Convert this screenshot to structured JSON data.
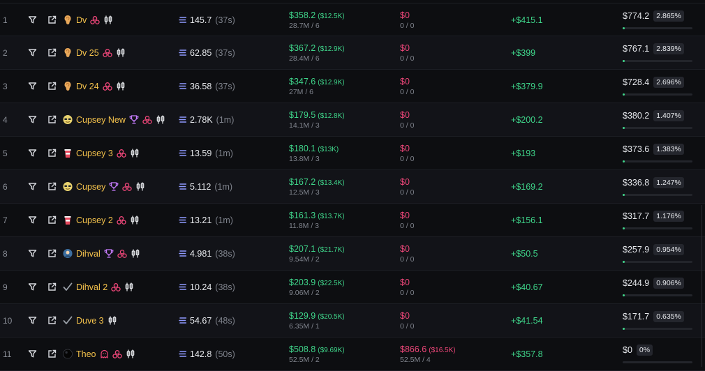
{
  "colors": {
    "accent_green": "#3fd58a",
    "accent_red": "#f0477a",
    "name_gold": "#f4c24c"
  },
  "rows": [
    {
      "rank": "1",
      "name": "Dv",
      "avatar_icon": "ear-icon",
      "badges": [
        "triple-circle-icon",
        "candlestick-icon"
      ],
      "balance": "145.7",
      "balance_age": "(37s)",
      "bought_usd": "$358.2",
      "bought_sub": "($12.5K)",
      "bought_detail": "28.7M / 6",
      "sold_usd": "$0",
      "sold_sub": "",
      "sold_detail": "0 / 0",
      "pnl": "+$415.1",
      "remaining_usd": "$774.2",
      "remaining_pct": "2.865%",
      "remaining_fraction": 0.02865
    },
    {
      "rank": "2",
      "name": "Dv 25",
      "avatar_icon": "ear-icon",
      "badges": [
        "triple-circle-icon",
        "candlestick-icon"
      ],
      "balance": "62.85",
      "balance_age": "(37s)",
      "bought_usd": "$367.2",
      "bought_sub": "($12.9K)",
      "bought_detail": "28.4M / 6",
      "sold_usd": "$0",
      "sold_sub": "",
      "sold_detail": "0 / 0",
      "pnl": "+$399",
      "remaining_usd": "$767.1",
      "remaining_pct": "2.839%",
      "remaining_fraction": 0.02839
    },
    {
      "rank": "3",
      "name": "Dv 24",
      "avatar_icon": "ear-icon",
      "badges": [
        "triple-circle-icon",
        "candlestick-icon"
      ],
      "balance": "36.58",
      "balance_age": "(37s)",
      "bought_usd": "$347.6",
      "bought_sub": "($12.9K)",
      "bought_detail": "27M / 6",
      "sold_usd": "$0",
      "sold_sub": "",
      "sold_detail": "0 / 0",
      "pnl": "+$379.9",
      "remaining_usd": "$728.4",
      "remaining_pct": "2.696%",
      "remaining_fraction": 0.02696
    },
    {
      "rank": "4",
      "name": "Cupsey New",
      "avatar_icon": "cup-face-icon",
      "badges": [
        "trophy-icon",
        "triple-circle-icon",
        "candlestick-icon"
      ],
      "balance": "2.78K",
      "balance_age": "(1m)",
      "bought_usd": "$179.5",
      "bought_sub": "($12.8K)",
      "bought_detail": "14.1M / 3",
      "sold_usd": "$0",
      "sold_sub": "",
      "sold_detail": "0 / 0",
      "pnl": "+$200.2",
      "remaining_usd": "$380.2",
      "remaining_pct": "1.407%",
      "remaining_fraction": 0.01407
    },
    {
      "rank": "5",
      "name": "Cupsey 3",
      "avatar_icon": "drink-cup-icon",
      "badges": [
        "triple-circle-icon",
        "candlestick-icon"
      ],
      "balance": "13.59",
      "balance_age": "(1m)",
      "bought_usd": "$180.1",
      "bought_sub": "($13K)",
      "bought_detail": "13.8M / 3",
      "sold_usd": "$0",
      "sold_sub": "",
      "sold_detail": "0 / 0",
      "pnl": "+$193",
      "remaining_usd": "$373.6",
      "remaining_pct": "1.383%",
      "remaining_fraction": 0.01383
    },
    {
      "rank": "6",
      "name": "Cupsey",
      "avatar_icon": "cup-face-icon",
      "badges": [
        "trophy-icon",
        "triple-circle-icon",
        "candlestick-icon"
      ],
      "balance": "5.112",
      "balance_age": "(1m)",
      "bought_usd": "$167.2",
      "bought_sub": "($13.4K)",
      "bought_detail": "12.5M / 3",
      "sold_usd": "$0",
      "sold_sub": "",
      "sold_detail": "0 / 0",
      "pnl": "+$169.2",
      "remaining_usd": "$336.8",
      "remaining_pct": "1.247%",
      "remaining_fraction": 0.01247
    },
    {
      "rank": "7",
      "name": "Cupsey 2",
      "avatar_icon": "drink-cup-icon",
      "badges": [
        "triple-circle-icon",
        "candlestick-icon"
      ],
      "balance": "13.21",
      "balance_age": "(1m)",
      "bought_usd": "$161.3",
      "bought_sub": "($13.7K)",
      "bought_detail": "11.8M / 3",
      "sold_usd": "$0",
      "sold_sub": "",
      "sold_detail": "0 / 0",
      "pnl": "+$156.1",
      "remaining_usd": "$317.7",
      "remaining_pct": "1.176%",
      "remaining_fraction": 0.01176
    },
    {
      "rank": "8",
      "name": "Dihval",
      "avatar_icon": "profile-photo-icon",
      "badges": [
        "trophy-icon",
        "triple-circle-icon",
        "candlestick-icon"
      ],
      "balance": "4.981",
      "balance_age": "(38s)",
      "bought_usd": "$207.1",
      "bought_sub": "($21.7K)",
      "bought_detail": "9.54M / 2",
      "sold_usd": "$0",
      "sold_sub": "",
      "sold_detail": "0 / 0",
      "pnl": "+$50.5",
      "remaining_usd": "$257.9",
      "remaining_pct": "0.954%",
      "remaining_fraction": 0.00954
    },
    {
      "rank": "9",
      "name": "Dihval 2",
      "avatar_icon": "checkmark-icon",
      "badges": [
        "triple-circle-icon",
        "candlestick-icon"
      ],
      "balance": "10.24",
      "balance_age": "(38s)",
      "bought_usd": "$203.9",
      "bought_sub": "($22.5K)",
      "bought_detail": "9.06M / 2",
      "sold_usd": "$0",
      "sold_sub": "",
      "sold_detail": "0 / 0",
      "pnl": "+$40.67",
      "remaining_usd": "$244.9",
      "remaining_pct": "0.906%",
      "remaining_fraction": 0.00906
    },
    {
      "rank": "10",
      "name": "Duve 3",
      "avatar_icon": "checkmark-icon",
      "badges": [
        "candlestick-icon"
      ],
      "balance": "54.67",
      "balance_age": "(48s)",
      "bought_usd": "$129.9",
      "bought_sub": "($20.5K)",
      "bought_detail": "6.35M / 1",
      "sold_usd": "$0",
      "sold_sub": "",
      "sold_detail": "0 / 0",
      "pnl": "+$41.54",
      "remaining_usd": "$171.7",
      "remaining_pct": "0.635%",
      "remaining_fraction": 0.00635
    },
    {
      "rank": "11",
      "name": "Theo",
      "avatar_icon": "black-circle-icon",
      "badges": [
        "ghost-icon",
        "triple-circle-icon",
        "candlestick-icon"
      ],
      "balance": "142.8",
      "balance_age": "(50s)",
      "bought_usd": "$508.8",
      "bought_sub": "($9.69K)",
      "bought_detail": "52.5M / 2",
      "sold_usd": "$866.6",
      "sold_sub": "($16.5K)",
      "sold_detail": "52.5M / 4",
      "pnl": "+$357.8",
      "remaining_usd": "$0",
      "remaining_pct": "0%",
      "remaining_fraction": 0
    }
  ]
}
